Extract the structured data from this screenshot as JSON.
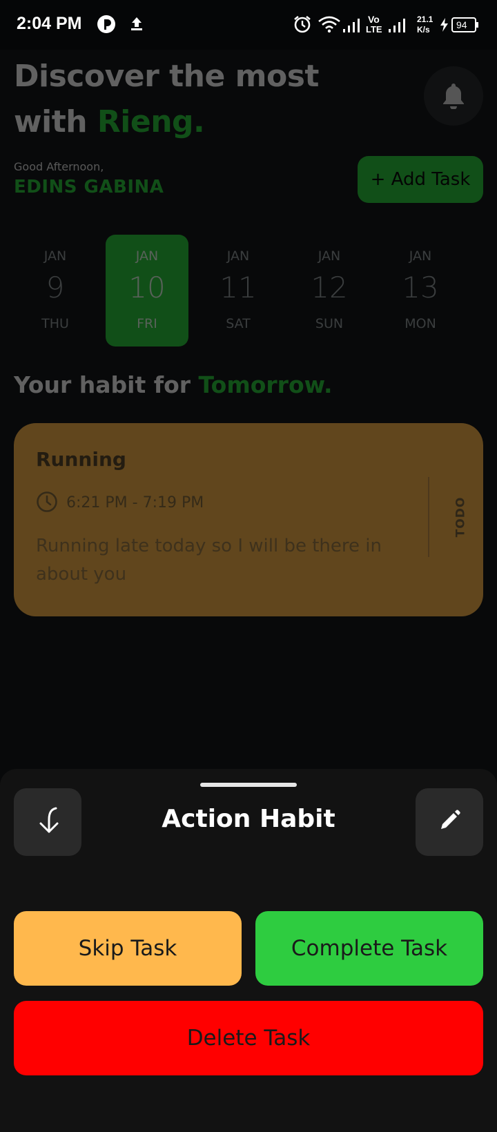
{
  "status_bar": {
    "time": "2:04 PM",
    "net_speed_value": "21.1",
    "net_speed_unit": "K/s",
    "battery": "94",
    "volte_top": "Vo",
    "volte_bottom": "LTE",
    "icons": [
      "app-logo-icon",
      "upload-icon",
      "alarm-icon",
      "wifi-icon",
      "signal-icon",
      "signal-icon",
      "charging-icon",
      "battery-icon"
    ]
  },
  "header": {
    "headline_line1": "Discover the most",
    "headline_line2_prefix": "with ",
    "headline_brand": "Rieng.",
    "greeting": "Good Afternoon,",
    "username": "EDINS GABINA",
    "add_task_label": "+ Add Task",
    "notification_icon": "bell-icon"
  },
  "dates": [
    {
      "month": "JAN",
      "day": "9",
      "weekday": "THU",
      "selected": false
    },
    {
      "month": "JAN",
      "day": "10",
      "weekday": "FRI",
      "selected": true
    },
    {
      "month": "JAN",
      "day": "11",
      "weekday": "SAT",
      "selected": false
    },
    {
      "month": "JAN",
      "day": "12",
      "weekday": "SUN",
      "selected": false
    },
    {
      "month": "JAN",
      "day": "13",
      "weekday": "MON",
      "selected": false
    }
  ],
  "habit_section": {
    "heading_prefix": "Your habit for ",
    "heading_accent": "Tomorrow."
  },
  "habit_card": {
    "title": "Running",
    "time_range": "6:21 PM - 7:19 PM",
    "description": "Running late today so I will be there in about you",
    "status": "TODO"
  },
  "sheet": {
    "title": "Action Habit",
    "back_icon": "arrow-return-icon",
    "edit_icon": "pencil-icon",
    "skip_label": "Skip Task",
    "complete_label": "Complete Task",
    "delete_label": "Delete Task"
  },
  "colors": {
    "accent_green": "#2fcf41",
    "card_orange": "#ffb84d",
    "delete_red": "#ff0000",
    "sheet_bg": "#121212"
  }
}
